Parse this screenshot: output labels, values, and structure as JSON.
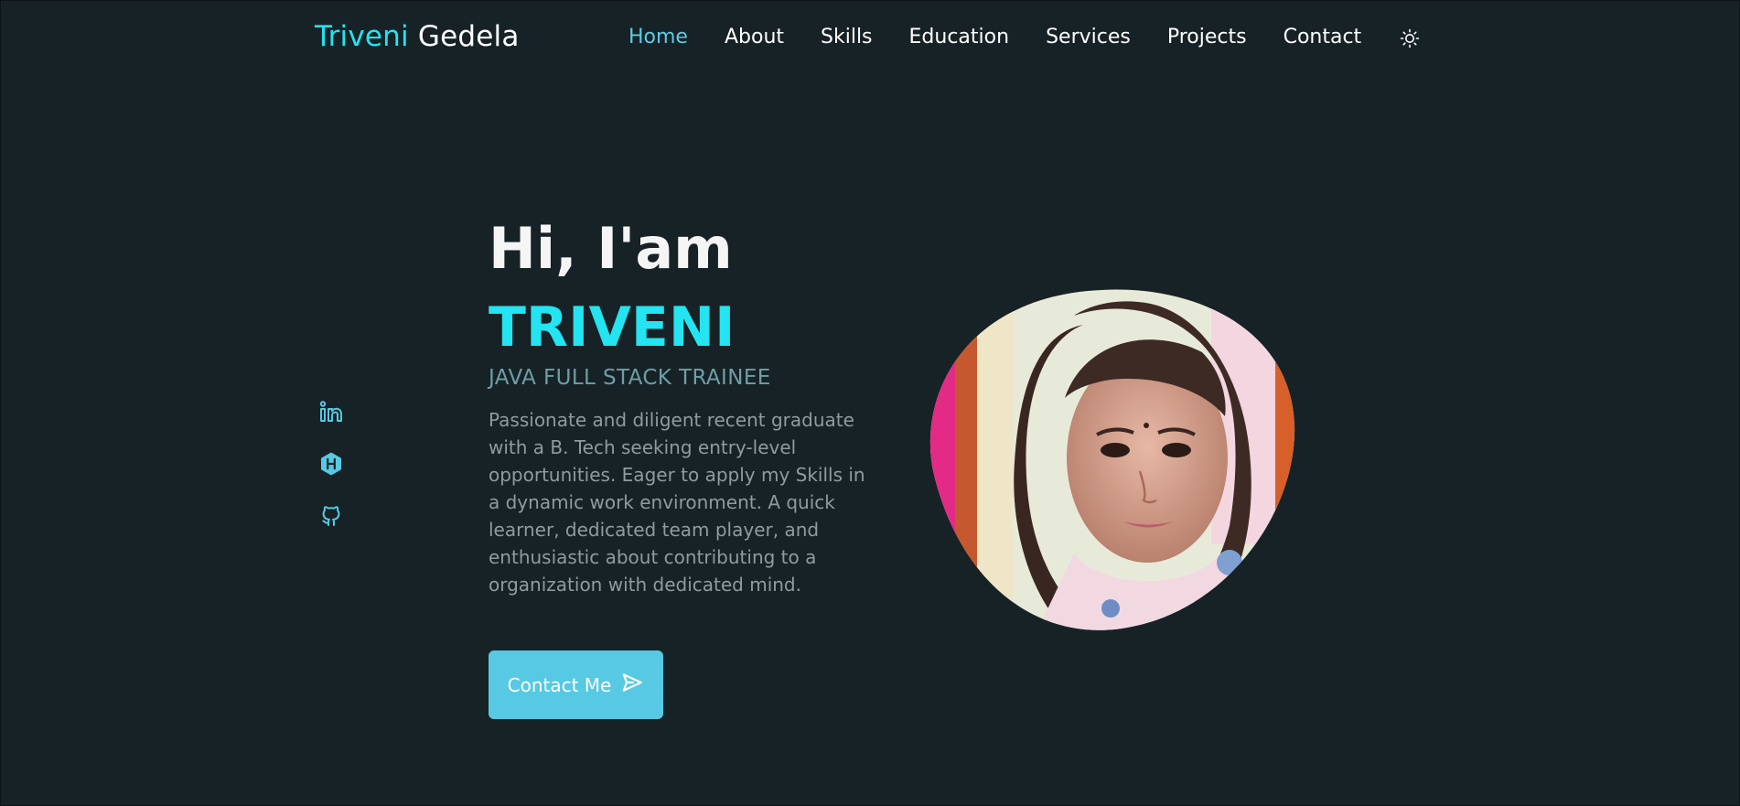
{
  "header": {
    "logo_first": "Triveni",
    "logo_last": "Gedela",
    "nav": [
      {
        "label": "Home"
      },
      {
        "label": "About"
      },
      {
        "label": "Skills"
      },
      {
        "label": "Education"
      },
      {
        "label": "Services"
      },
      {
        "label": "Projects"
      },
      {
        "label": "Contact"
      }
    ],
    "active_nav": "Home",
    "theme_icon": "sun-icon"
  },
  "social": [
    {
      "icon": "linkedin-icon"
    },
    {
      "icon": "hashnode-icon"
    },
    {
      "icon": "github-icon"
    }
  ],
  "hero": {
    "greeting": "Hi, I'am",
    "name": "TRIVENI",
    "role": "JAVA FULL STACK TRAINEE",
    "description": "Passionate and diligent recent graduate with a B. Tech seeking entry-level opportunities. Eager to apply my Skills in a dynamic work environment. A quick learner, dedicated team player, and enthusiastic about contributing to a organization with dedicated mind.",
    "cta_label": "Contact Me",
    "cta_icon": "send-icon"
  },
  "colors": {
    "background": "#172226",
    "accent": "#23e4f0",
    "button": "#57c9e2",
    "nav_active": "#5ccbe6",
    "role_text": "#6e9ea6"
  }
}
